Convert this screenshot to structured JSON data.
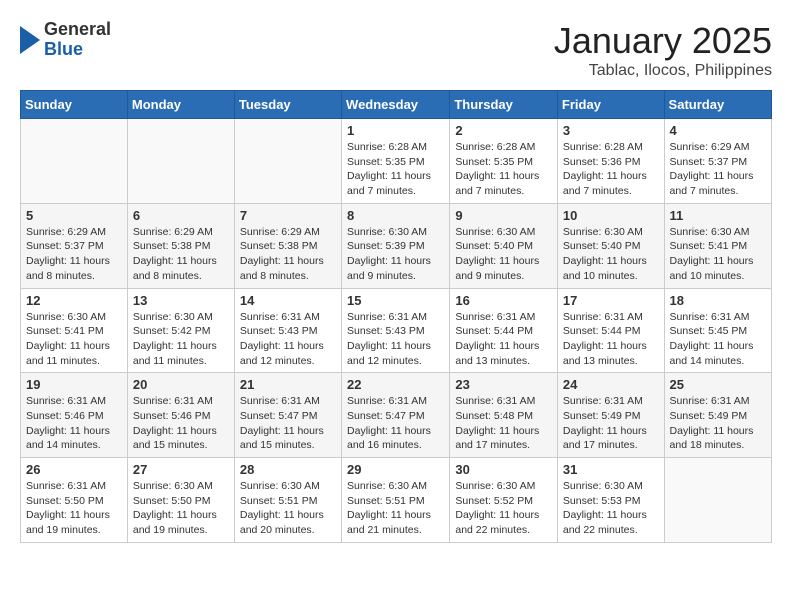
{
  "logo": {
    "general": "General",
    "blue": "Blue"
  },
  "title": "January 2025",
  "subtitle": "Tablac, Ilocos, Philippines",
  "weekdays": [
    "Sunday",
    "Monday",
    "Tuesday",
    "Wednesday",
    "Thursday",
    "Friday",
    "Saturday"
  ],
  "weeks": [
    [
      {
        "day": "",
        "info": ""
      },
      {
        "day": "",
        "info": ""
      },
      {
        "day": "",
        "info": ""
      },
      {
        "day": "1",
        "info": "Sunrise: 6:28 AM\nSunset: 5:35 PM\nDaylight: 11 hours and 7 minutes."
      },
      {
        "day": "2",
        "info": "Sunrise: 6:28 AM\nSunset: 5:35 PM\nDaylight: 11 hours and 7 minutes."
      },
      {
        "day": "3",
        "info": "Sunrise: 6:28 AM\nSunset: 5:36 PM\nDaylight: 11 hours and 7 minutes."
      },
      {
        "day": "4",
        "info": "Sunrise: 6:29 AM\nSunset: 5:37 PM\nDaylight: 11 hours and 7 minutes."
      }
    ],
    [
      {
        "day": "5",
        "info": "Sunrise: 6:29 AM\nSunset: 5:37 PM\nDaylight: 11 hours and 8 minutes."
      },
      {
        "day": "6",
        "info": "Sunrise: 6:29 AM\nSunset: 5:38 PM\nDaylight: 11 hours and 8 minutes."
      },
      {
        "day": "7",
        "info": "Sunrise: 6:29 AM\nSunset: 5:38 PM\nDaylight: 11 hours and 8 minutes."
      },
      {
        "day": "8",
        "info": "Sunrise: 6:30 AM\nSunset: 5:39 PM\nDaylight: 11 hours and 9 minutes."
      },
      {
        "day": "9",
        "info": "Sunrise: 6:30 AM\nSunset: 5:40 PM\nDaylight: 11 hours and 9 minutes."
      },
      {
        "day": "10",
        "info": "Sunrise: 6:30 AM\nSunset: 5:40 PM\nDaylight: 11 hours and 10 minutes."
      },
      {
        "day": "11",
        "info": "Sunrise: 6:30 AM\nSunset: 5:41 PM\nDaylight: 11 hours and 10 minutes."
      }
    ],
    [
      {
        "day": "12",
        "info": "Sunrise: 6:30 AM\nSunset: 5:41 PM\nDaylight: 11 hours and 11 minutes."
      },
      {
        "day": "13",
        "info": "Sunrise: 6:30 AM\nSunset: 5:42 PM\nDaylight: 11 hours and 11 minutes."
      },
      {
        "day": "14",
        "info": "Sunrise: 6:31 AM\nSunset: 5:43 PM\nDaylight: 11 hours and 12 minutes."
      },
      {
        "day": "15",
        "info": "Sunrise: 6:31 AM\nSunset: 5:43 PM\nDaylight: 11 hours and 12 minutes."
      },
      {
        "day": "16",
        "info": "Sunrise: 6:31 AM\nSunset: 5:44 PM\nDaylight: 11 hours and 13 minutes."
      },
      {
        "day": "17",
        "info": "Sunrise: 6:31 AM\nSunset: 5:44 PM\nDaylight: 11 hours and 13 minutes."
      },
      {
        "day": "18",
        "info": "Sunrise: 6:31 AM\nSunset: 5:45 PM\nDaylight: 11 hours and 14 minutes."
      }
    ],
    [
      {
        "day": "19",
        "info": "Sunrise: 6:31 AM\nSunset: 5:46 PM\nDaylight: 11 hours and 14 minutes."
      },
      {
        "day": "20",
        "info": "Sunrise: 6:31 AM\nSunset: 5:46 PM\nDaylight: 11 hours and 15 minutes."
      },
      {
        "day": "21",
        "info": "Sunrise: 6:31 AM\nSunset: 5:47 PM\nDaylight: 11 hours and 15 minutes."
      },
      {
        "day": "22",
        "info": "Sunrise: 6:31 AM\nSunset: 5:47 PM\nDaylight: 11 hours and 16 minutes."
      },
      {
        "day": "23",
        "info": "Sunrise: 6:31 AM\nSunset: 5:48 PM\nDaylight: 11 hours and 17 minutes."
      },
      {
        "day": "24",
        "info": "Sunrise: 6:31 AM\nSunset: 5:49 PM\nDaylight: 11 hours and 17 minutes."
      },
      {
        "day": "25",
        "info": "Sunrise: 6:31 AM\nSunset: 5:49 PM\nDaylight: 11 hours and 18 minutes."
      }
    ],
    [
      {
        "day": "26",
        "info": "Sunrise: 6:31 AM\nSunset: 5:50 PM\nDaylight: 11 hours and 19 minutes."
      },
      {
        "day": "27",
        "info": "Sunrise: 6:30 AM\nSunset: 5:50 PM\nDaylight: 11 hours and 19 minutes."
      },
      {
        "day": "28",
        "info": "Sunrise: 6:30 AM\nSunset: 5:51 PM\nDaylight: 11 hours and 20 minutes."
      },
      {
        "day": "29",
        "info": "Sunrise: 6:30 AM\nSunset: 5:51 PM\nDaylight: 11 hours and 21 minutes."
      },
      {
        "day": "30",
        "info": "Sunrise: 6:30 AM\nSunset: 5:52 PM\nDaylight: 11 hours and 22 minutes."
      },
      {
        "day": "31",
        "info": "Sunrise: 6:30 AM\nSunset: 5:53 PM\nDaylight: 11 hours and 22 minutes."
      },
      {
        "day": "",
        "info": ""
      }
    ]
  ]
}
